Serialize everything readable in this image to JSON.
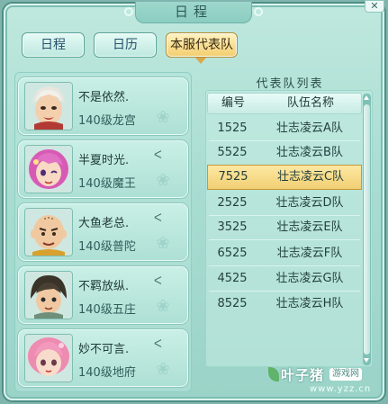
{
  "window": {
    "title": "日程",
    "close_icon": "close-icon"
  },
  "tabs": [
    {
      "label": "日程",
      "active": false
    },
    {
      "label": "日历",
      "active": false
    },
    {
      "label": "本服代表队",
      "active": true
    }
  ],
  "members": [
    {
      "name": "不是依然.",
      "level": "140级龙宫",
      "flag": "",
      "avatar": "avatar-white-hair-boy"
    },
    {
      "name": "半夏时光.",
      "level": "140级魔王",
      "flag": "ᐸ",
      "avatar": "avatar-pink-hair-girl"
    },
    {
      "name": "大鱼老总.",
      "level": "140级普陀",
      "flag": "ᐸ",
      "avatar": "avatar-bald-monk"
    },
    {
      "name": "不羁放纵.",
      "level": "140级五庄",
      "flag": "ᐸ",
      "avatar": "avatar-dark-hair-boy"
    },
    {
      "name": "妙不可言.",
      "level": "140级地府",
      "flag": "ᐸ",
      "avatar": "avatar-pink-hair-girl-2"
    }
  ],
  "team_list": {
    "title": "代表队列表",
    "header_id": "编号",
    "header_name": "队伍名称",
    "selected_index": 2,
    "rows": [
      {
        "id": "1525",
        "name": "壮志凌云A队"
      },
      {
        "id": "5525",
        "name": "壮志凌云B队"
      },
      {
        "id": "7525",
        "name": "壮志凌云C队"
      },
      {
        "id": "2525",
        "name": "壮志凌云D队"
      },
      {
        "id": "3525",
        "name": "壮志凌云E队"
      },
      {
        "id": "6525",
        "name": "壮志凌云F队"
      },
      {
        "id": "4525",
        "name": "壮志凌云G队"
      },
      {
        "id": "8525",
        "name": "壮志凌云H队"
      }
    ]
  },
  "watermark": {
    "brand": "叶子猪",
    "tag": "游戏网",
    "url": "www.yzz.cn"
  }
}
